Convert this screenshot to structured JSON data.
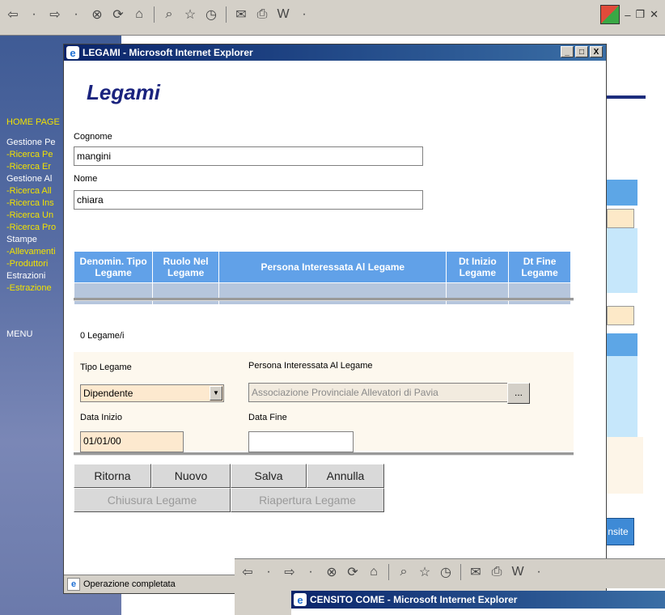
{
  "toolbar": {
    "icons": [
      "back-arrow-icon",
      "forward-arrow-icon",
      "stop-icon",
      "refresh-icon",
      "home-icon",
      "search-icon",
      "favorites-icon",
      "history-icon",
      "mail-icon",
      "print-icon",
      "word-icon"
    ],
    "glyphs": {
      "back": "⇦",
      "forward": "⇨",
      "stop": "⊗",
      "refresh": "⟳",
      "home": "⌂",
      "search": "⌕",
      "favorites": "☆",
      "history": "◷",
      "mail": "✉",
      "print": "⎙",
      "word": "W",
      "dropdown": "·",
      "minimize": "–",
      "restore": "❐",
      "close": "✕"
    }
  },
  "background_nav": {
    "items": [
      {
        "text": "HOME PAGE",
        "color": "yellow"
      },
      {
        "text": "Gestione Pe",
        "color": "white"
      },
      {
        "text": "-Ricerca Pe",
        "color": "yellow"
      },
      {
        "text": "-Ricerca Er",
        "color": "yellow"
      },
      {
        "text": "Gestione Al",
        "color": "white"
      },
      {
        "text": "-Ricerca All",
        "color": "yellow"
      },
      {
        "text": "-Ricerca Ins",
        "color": "yellow"
      },
      {
        "text": "-Ricerca Un",
        "color": "yellow"
      },
      {
        "text": "-Ricerca Pro",
        "color": "yellow"
      },
      {
        "text": "Stampe",
        "color": "white"
      },
      {
        "text": "-Allevamenti",
        "color": "yellow"
      },
      {
        "text": "-Produttori",
        "color": "yellow"
      },
      {
        "text": "Estrazioni",
        "color": "white"
      },
      {
        "text": "-Estrazione",
        "color": "yellow"
      },
      {
        "text": "MENU",
        "color": "white"
      }
    ],
    "button_label": "nsite"
  },
  "window": {
    "title": "LEGAMI - Microsoft Internet Explorer",
    "controls": {
      "minimize": "_",
      "maximize": "□",
      "close": "X"
    }
  },
  "page": {
    "title": "Legami",
    "cognome_label": "Cognome",
    "cognome_value": "mangini",
    "nome_label": "Nome",
    "nome_value": "chiara"
  },
  "table": {
    "headers": [
      "Denomin. Tipo Legame",
      "Ruolo Nel Legame",
      "Persona Interessata Al Legame",
      "Dt Inizio Legame",
      "Dt Fine Legame"
    ],
    "rows": [
      [
        "",
        "",
        "",
        "",
        ""
      ]
    ]
  },
  "count_text": "0 Legame/i",
  "form": {
    "tipo_legame_label": "Tipo Legame",
    "tipo_legame_value": "Dipendente",
    "persona_label": "Persona Interessata Al Legame",
    "persona_value": "Associazione Provinciale Allevatori di Pavia",
    "dots_label": "...",
    "data_inizio_label": "Data Inizio",
    "data_inizio_value": "01/01/00",
    "data_fine_label": "Data Fine",
    "data_fine_value": ""
  },
  "buttons": {
    "ritorna": "Ritorna",
    "nuovo": "Nuovo",
    "salva": "Salva",
    "annulla": "Annulla",
    "chiusura": "Chiusura Legame",
    "riapertura": "Riapertura Legame"
  },
  "status": {
    "text": "Operazione completata"
  },
  "second_window": {
    "title": "CENSITO COME - Microsoft Internet Explorer"
  }
}
